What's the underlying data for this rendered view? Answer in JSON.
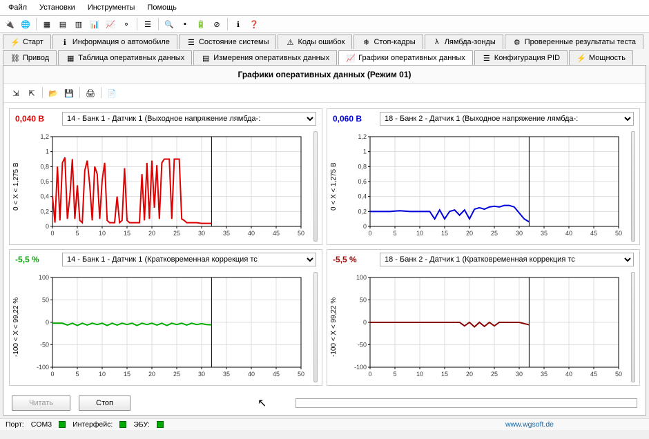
{
  "menubar": [
    "Файл",
    "Установки",
    "Инструменты",
    "Помощь"
  ],
  "tabs_row1": [
    {
      "label": "Старт",
      "icon": "spark"
    },
    {
      "label": "Информация о автомобиле",
      "icon": "info"
    },
    {
      "label": "Состояние системы",
      "icon": "status"
    },
    {
      "label": "Коды ошибок",
      "icon": "warn"
    },
    {
      "label": "Стоп-кадры",
      "icon": "freeze"
    },
    {
      "label": "Лямбда-зонды",
      "icon": "lambda"
    },
    {
      "label": "Проверенные результаты теста",
      "icon": "gear"
    }
  ],
  "tabs_row2": [
    {
      "label": "Привод",
      "icon": "drive",
      "active": false
    },
    {
      "label": "Таблица оперативных данных",
      "icon": "table",
      "active": false
    },
    {
      "label": "Измерения оперативных данных",
      "icon": "measure",
      "active": false
    },
    {
      "label": "Графики оперативных данных",
      "icon": "chart",
      "active": true
    },
    {
      "label": "Конфигурация PID",
      "icon": "pid",
      "active": false
    },
    {
      "label": "Мощность",
      "icon": "power",
      "active": false
    }
  ],
  "panel_title": "Графики оперативных данных (Режим 01)",
  "charts": [
    {
      "value": "0,040 В",
      "value_color": "#d00",
      "selector": "14 - Банк 1 - Датчик 1 (Выходное напряжение лямбда-:",
      "ylabel": "0  < X <  1,275  В",
      "color": "#d00"
    },
    {
      "value": "0,060 В",
      "value_color": "#00d",
      "selector": "18 - Банк 2 - Датчик 1 (Выходное напряжение лямбда-:",
      "ylabel": "0  < X <  1,275  В",
      "color": "#00d"
    },
    {
      "value": "-5,5 %",
      "value_color": "#0a0",
      "selector": "14 - Банк 1 - Датчик 1 (Кратковременная коррекция тс",
      "ylabel": "-100  < X <  99,22   %",
      "color": "#0a0"
    },
    {
      "value": "-5,5 %",
      "value_color": "#a00",
      "selector": "18 - Банк 2 - Датчик 1 (Кратковременная коррекция тс",
      "ylabel": "-100  < X <  99,22   %",
      "color": "#800"
    }
  ],
  "buttons": {
    "read": "Читать",
    "stop": "Стоп"
  },
  "status": {
    "port_label": "Порт:",
    "port": "COM3",
    "iface_label": "Интерфейс:",
    "ecu_label": "ЭБУ:",
    "url": "www.wgsoft.de"
  },
  "chart_data": [
    {
      "type": "line",
      "xlim": [
        0,
        50
      ],
      "ylim": [
        0,
        1.2
      ],
      "yticks": [
        0,
        0.2,
        0.4,
        0.6,
        0.8,
        1.0,
        1.2
      ],
      "xticks": [
        0,
        5,
        10,
        15,
        20,
        25,
        30,
        35,
        40,
        45,
        50
      ],
      "marker_x": 32,
      "x": [
        0,
        0.5,
        1,
        1.5,
        2,
        2.5,
        3,
        3.5,
        4,
        4.5,
        5,
        5.5,
        6,
        6.5,
        7,
        7.5,
        8,
        8.5,
        9,
        9.5,
        10,
        10.5,
        11,
        11.5,
        12,
        12.5,
        13,
        13.5,
        14,
        14.5,
        15,
        15.5,
        16,
        16.5,
        17,
        17.5,
        18,
        18.5,
        19,
        19.5,
        20,
        20.5,
        21,
        21.5,
        22,
        22.5,
        23,
        23.5,
        24,
        24.5,
        25,
        25.5,
        26,
        26.5,
        27,
        28,
        29,
        30,
        31,
        32
      ],
      "y": [
        0.4,
        0.05,
        0.8,
        0.08,
        0.85,
        0.92,
        0.1,
        0.4,
        0.9,
        0.1,
        0.55,
        0.08,
        0.05,
        0.75,
        0.88,
        0.55,
        0.08,
        0.8,
        0.7,
        0.1,
        0.62,
        0.85,
        0.08,
        0.05,
        0.05,
        0.05,
        0.4,
        0.05,
        0.08,
        0.78,
        0.08,
        0.05,
        0.05,
        0.05,
        0.05,
        0.05,
        0.7,
        0.08,
        0.85,
        0.1,
        0.88,
        0.25,
        0.82,
        0.1,
        0.85,
        0.9,
        0.9,
        0.9,
        0.1,
        0.9,
        0.9,
        0.9,
        0.1,
        0.08,
        0.05,
        0.05,
        0.05,
        0.04,
        0.04,
        0.04
      ]
    },
    {
      "type": "line",
      "xlim": [
        0,
        50
      ],
      "ylim": [
        0,
        1.2
      ],
      "yticks": [
        0,
        0.2,
        0.4,
        0.6,
        0.8,
        1.0,
        1.2
      ],
      "xticks": [
        0,
        5,
        10,
        15,
        20,
        25,
        30,
        35,
        40,
        45,
        50
      ],
      "marker_x": 32,
      "x": [
        0,
        2,
        4,
        6,
        8,
        10,
        12,
        13,
        14,
        15,
        16,
        17,
        18,
        19,
        20,
        21,
        22,
        23,
        24,
        25,
        26,
        27,
        28,
        29,
        30,
        31,
        32
      ],
      "y": [
        0.2,
        0.2,
        0.2,
        0.21,
        0.2,
        0.2,
        0.2,
        0.1,
        0.22,
        0.1,
        0.2,
        0.22,
        0.15,
        0.22,
        0.1,
        0.23,
        0.25,
        0.23,
        0.26,
        0.27,
        0.26,
        0.28,
        0.28,
        0.26,
        0.18,
        0.1,
        0.06
      ]
    },
    {
      "type": "line",
      "xlim": [
        0,
        50
      ],
      "ylim": [
        -100,
        100
      ],
      "yticks": [
        -100,
        -50,
        0,
        50,
        100
      ],
      "xticks": [
        0,
        5,
        10,
        15,
        20,
        25,
        30,
        35,
        40,
        45,
        50
      ],
      "marker_x": 32,
      "x": [
        0,
        2,
        3,
        4,
        5,
        6,
        7,
        8,
        9,
        10,
        11,
        12,
        13,
        14,
        15,
        16,
        17,
        18,
        19,
        20,
        21,
        22,
        23,
        24,
        25,
        26,
        27,
        28,
        29,
        30,
        31,
        32
      ],
      "y": [
        -2,
        -2,
        -6,
        -2,
        -7,
        -2,
        -6,
        -2,
        -5,
        -2,
        -7,
        -2,
        -6,
        -2,
        -5,
        -2,
        -7,
        -2,
        -5,
        -2,
        -6,
        -2,
        -7,
        -2,
        -5,
        -2,
        -6,
        -2,
        -5,
        -3,
        -5,
        -5.5
      ]
    },
    {
      "type": "line",
      "xlim": [
        0,
        50
      ],
      "ylim": [
        -100,
        100
      ],
      "yticks": [
        -100,
        -50,
        0,
        50,
        100
      ],
      "xticks": [
        0,
        5,
        10,
        15,
        20,
        25,
        30,
        35,
        40,
        45,
        50
      ],
      "marker_x": 32,
      "x": [
        0,
        5,
        10,
        15,
        18,
        19,
        20,
        21,
        22,
        23,
        24,
        25,
        26,
        28,
        30,
        32
      ],
      "y": [
        0,
        0,
        0,
        0,
        0,
        -8,
        0,
        -10,
        0,
        -9,
        0,
        -8,
        0,
        0,
        0,
        -5.5
      ]
    }
  ]
}
